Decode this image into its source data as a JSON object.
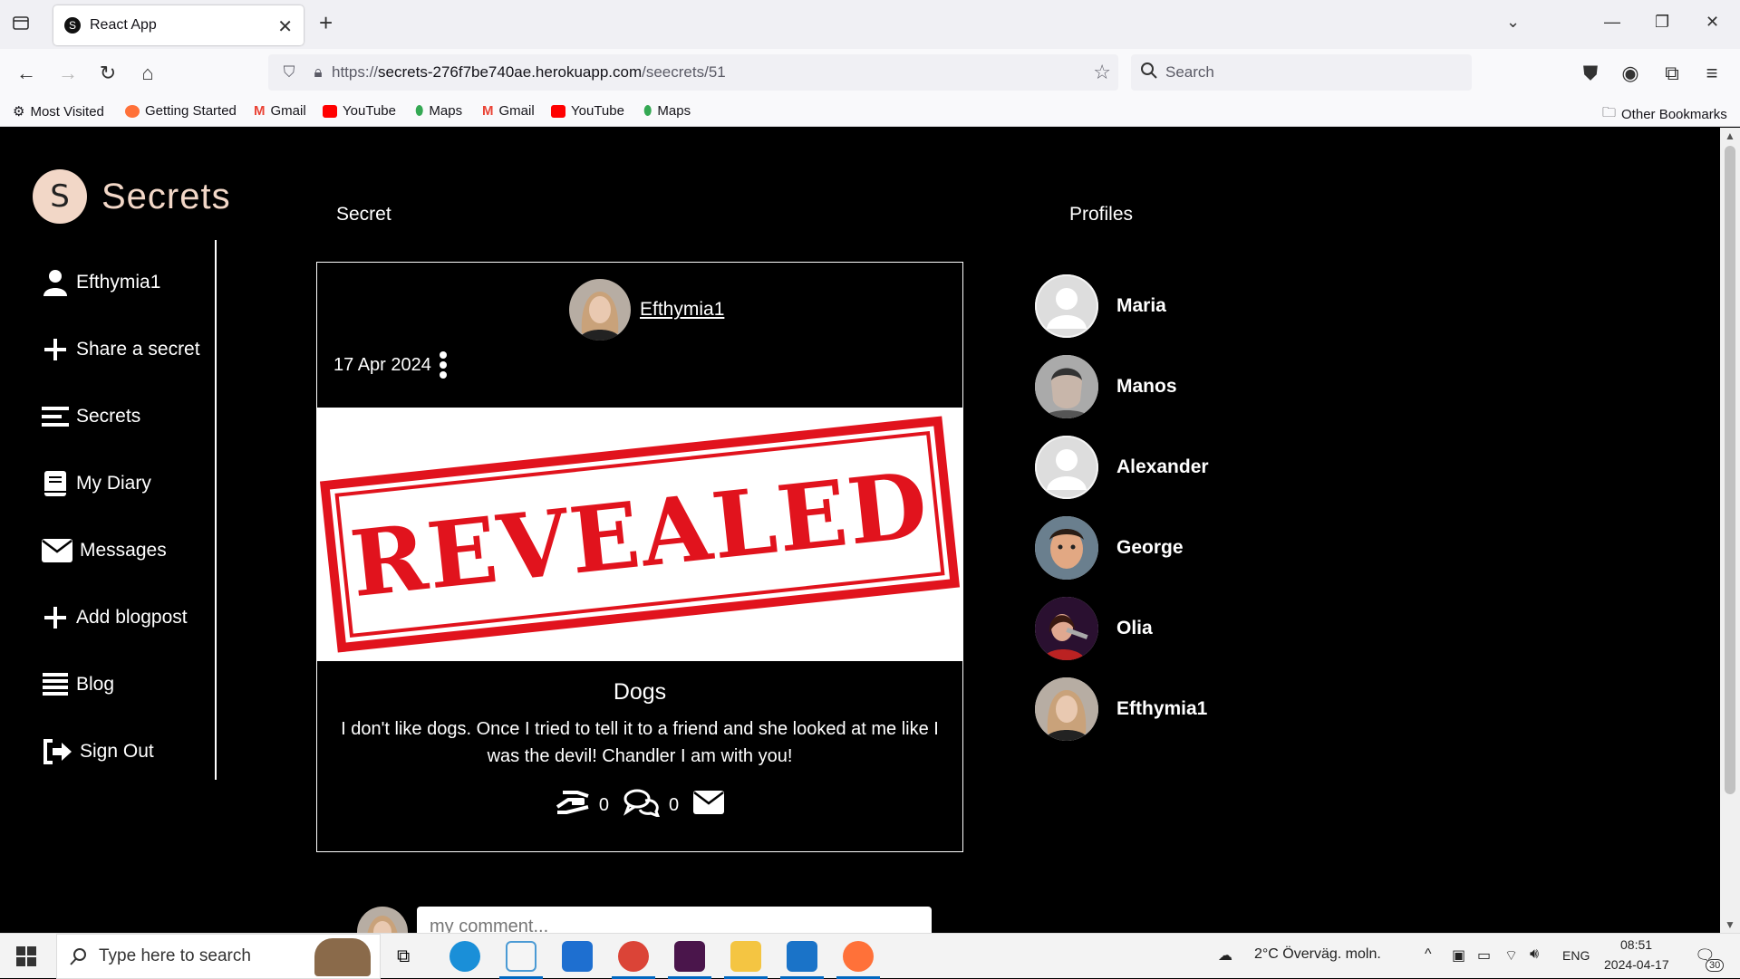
{
  "browser": {
    "tab_title": "React App",
    "tab_favicon_letter": "S",
    "url_prefix": "https://",
    "url_host": "secrets-276f7be740ae.herokuapp.com",
    "url_path": "/seecrets/51",
    "search_placeholder": "Search",
    "bookmarks": [
      "Most Visited",
      "Getting Started",
      "Gmail",
      "YouTube",
      "Maps",
      "Gmail",
      "YouTube",
      "Maps"
    ],
    "other_bookmarks": "Other Bookmarks"
  },
  "app": {
    "logo_letter": "S",
    "logo_text": "Secrets",
    "accent_color": "#f2d7c7",
    "sidebar": [
      {
        "label": "Efthymia1",
        "icon": "user-icon"
      },
      {
        "label": "Share a secret",
        "icon": "plus-icon"
      },
      {
        "label": "Secrets",
        "icon": "menu-icon"
      },
      {
        "label": "My Diary",
        "icon": "book-icon"
      },
      {
        "label": "Messages",
        "icon": "envelope-icon"
      },
      {
        "label": "Add blogpost",
        "icon": "plus-icon"
      },
      {
        "label": "Blog",
        "icon": "list-icon"
      },
      {
        "label": "Sign Out",
        "icon": "sign-out-icon"
      }
    ],
    "secret_heading": "Secret",
    "profiles_heading": "Profiles",
    "secret": {
      "author": "Efthymia1",
      "date": "17 Apr 2024",
      "image_text": "REVEALED",
      "title": "Dogs",
      "body": "I don't like dogs. Once I tried to tell it to a friend and she looked at me like I was the devil! Chandler I am with you!",
      "support_count": "0",
      "comment_count": "0"
    },
    "profiles": [
      "Maria",
      "Manos",
      "Alexander",
      "George",
      "Olia",
      "Efthymia1"
    ],
    "comment_placeholder": "my comment..."
  },
  "taskbar": {
    "search_placeholder": "Type here to search",
    "weather": "2°C  Överväg. moln.",
    "language": "ENG",
    "time": "08:51",
    "date": "2024-04-17",
    "notifications": "30"
  }
}
